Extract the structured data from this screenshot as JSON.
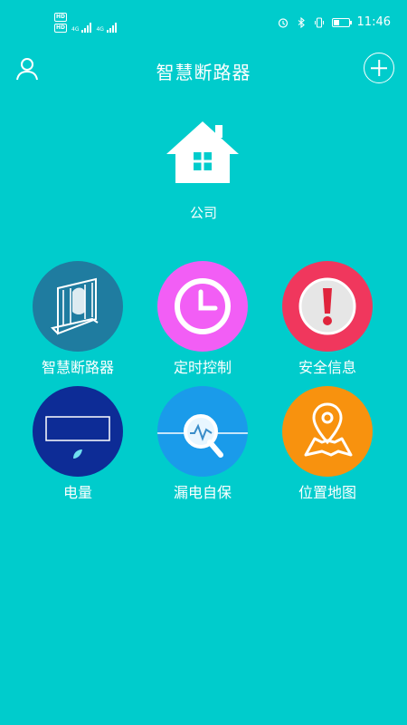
{
  "status": {
    "hd1": "HD",
    "net1": "4G",
    "hd2": "HD",
    "net2": "4G",
    "time": "11:46",
    "battery_percent": 40
  },
  "header": {
    "title": "智慧断路器"
  },
  "location": {
    "name": "公司"
  },
  "menu": {
    "items": [
      {
        "label": "智慧断路器",
        "color": "#1F7CA0",
        "icon": "breaker-icon"
      },
      {
        "label": "定时控制",
        "color": "#F25EF5",
        "icon": "clock-icon"
      },
      {
        "label": "安全信息",
        "color": "#F0375D",
        "icon": "alert-icon"
      },
      {
        "label": "电量",
        "color": "#0D2C96",
        "icon": "meter-icon"
      },
      {
        "label": "漏电自保",
        "color": "#1A9BEA",
        "icon": "leak-detect-icon"
      },
      {
        "label": "位置地图",
        "color": "#F8920E",
        "icon": "map-pin-icon"
      }
    ]
  }
}
